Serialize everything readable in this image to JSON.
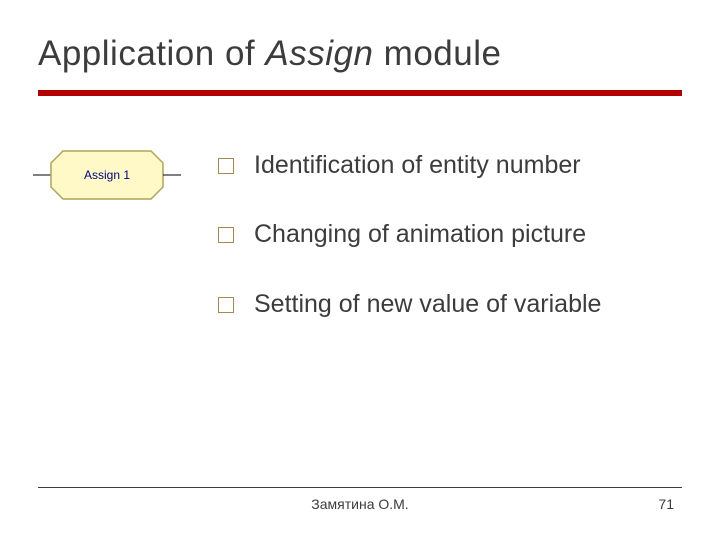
{
  "title": {
    "prefix": "Application of ",
    "italic": "Assign",
    "suffix": " module"
  },
  "module": {
    "label": "Assign 1"
  },
  "bullets": [
    {
      "text": "Identification of entity number"
    },
    {
      "text": "Changing of animation picture"
    },
    {
      "text": "Setting of new value of variable"
    }
  ],
  "footer": {
    "author": "Замятина О.М.",
    "page": "71"
  }
}
